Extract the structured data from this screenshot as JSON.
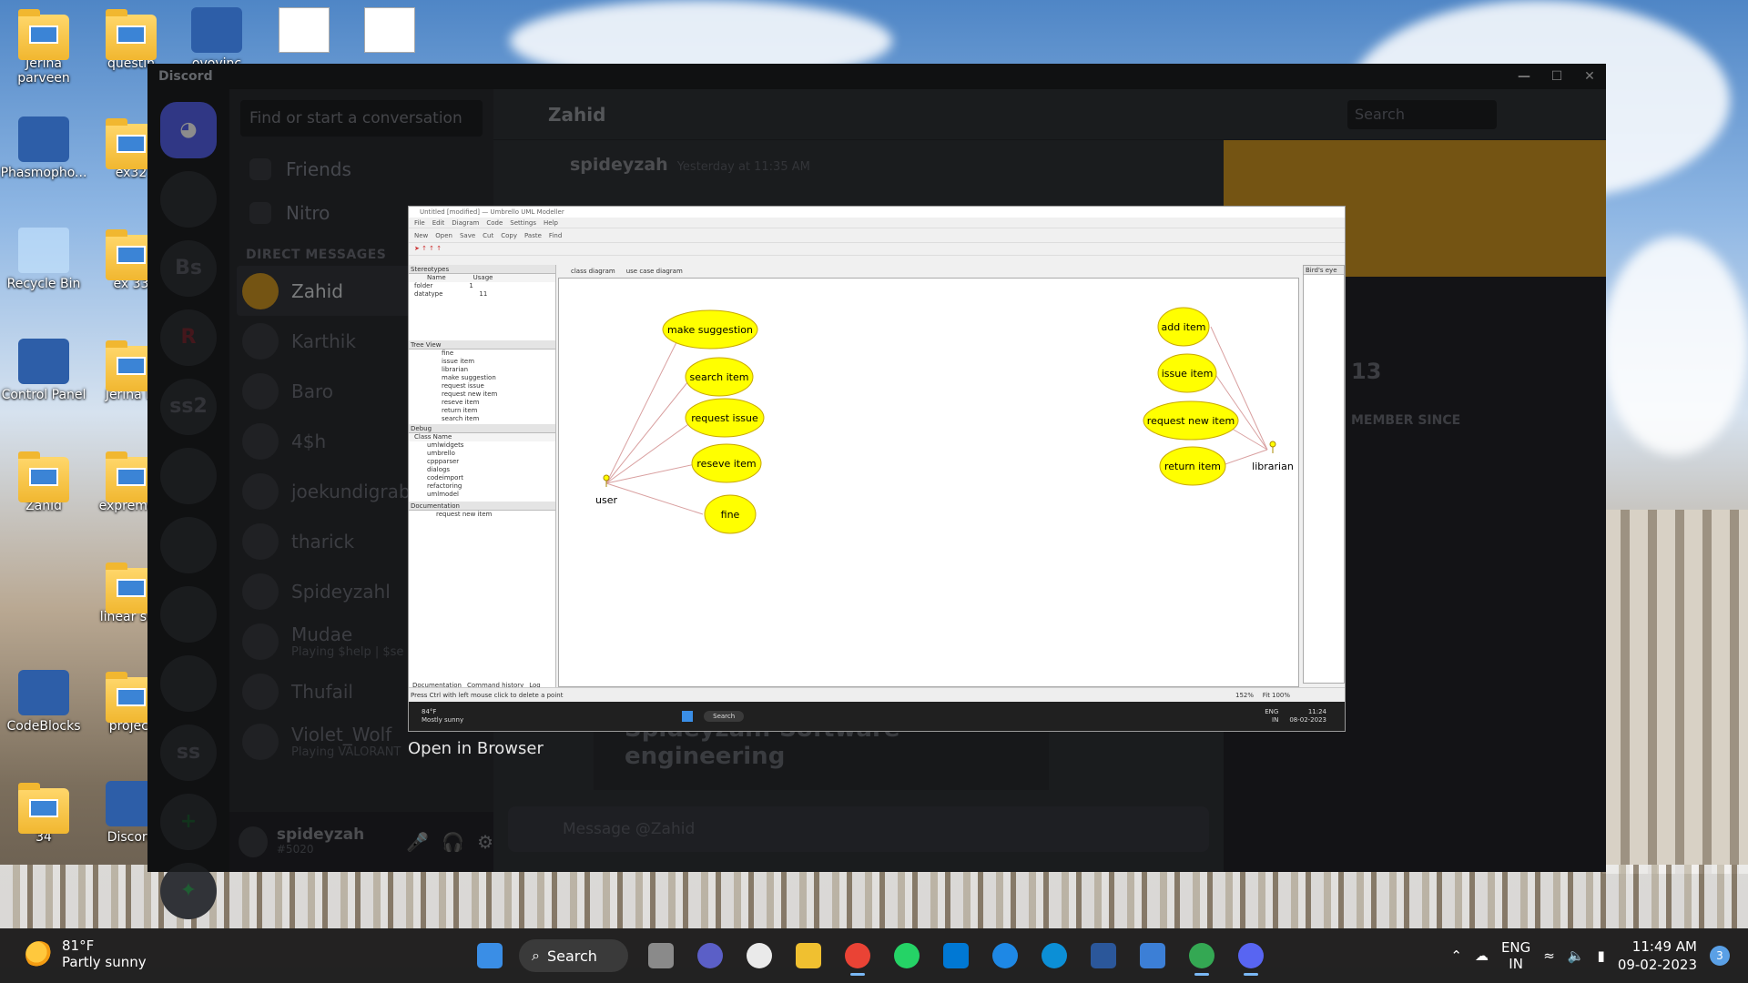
{
  "desktop": {
    "icons": [
      {
        "label": "Jerina parveen",
        "kind": "folder"
      },
      {
        "label": "questin",
        "kind": "folder"
      },
      {
        "label": "ovovinc",
        "kind": "app"
      },
      {
        "label": "",
        "kind": "doc"
      },
      {
        "label": "",
        "kind": "doc"
      },
      {
        "label": "Phasmopho...",
        "kind": "app"
      },
      {
        "label": "ex32",
        "kind": "folder"
      },
      {
        "label": "Recycle Bin",
        "kind": "bin"
      },
      {
        "label": "ex 33",
        "kind": "folder"
      },
      {
        "label": "Control Panel",
        "kind": "app"
      },
      {
        "label": "Jerina M",
        "kind": "folder"
      },
      {
        "label": "Zahid",
        "kind": "folder"
      },
      {
        "label": "expremen",
        "kind": "folder"
      },
      {
        "label": "linear sea",
        "kind": "folder"
      },
      {
        "label": "CodeBlocks",
        "kind": "app"
      },
      {
        "label": "project",
        "kind": "folder"
      },
      {
        "label": "34",
        "kind": "folder"
      },
      {
        "label": "Discord",
        "kind": "app"
      }
    ]
  },
  "discord": {
    "title": "Discord",
    "search_placeholder": "Find or start a conversation",
    "nav": [
      "Friends",
      "Nitro"
    ],
    "dm_header": "DIRECT MESSAGES",
    "guilds": [
      "Bs",
      "ss2",
      "ss"
    ],
    "dms": [
      {
        "name": "Zahid",
        "sub": ""
      },
      {
        "name": "Karthik",
        "sub": ""
      },
      {
        "name": "Baro",
        "sub": ""
      },
      {
        "name": "4$h",
        "sub": ""
      },
      {
        "name": "joekundigrabe",
        "sub": ""
      },
      {
        "name": "tharick",
        "sub": ""
      },
      {
        "name": "Spideyzahl",
        "sub": ""
      },
      {
        "name": "Mudae",
        "sub": "Playing $help | $se"
      },
      {
        "name": "Thufail",
        "sub": ""
      },
      {
        "name": "Violet_Wolf",
        "sub": "Playing VALORANT"
      }
    ],
    "user": {
      "name": "spideyzah",
      "tag": "#5020"
    },
    "header_name": "Zahid",
    "header_search": "Search",
    "message_author": "spideyzah",
    "message_time": "Yesterday at 11:35 AM",
    "embed_text": "Spideyzah: Software engineering",
    "profile": {
      "member_since": "MEMBER SINCE",
      "year_fragment": "13"
    },
    "message_placeholder": "Message @Zahid",
    "open_in_browser": "Open in Browser"
  },
  "umbrello": {
    "title": "Untitled [modified] — Umbrello UML Modeller",
    "menu": [
      "File",
      "Edit",
      "Diagram",
      "Code",
      "Settings",
      "Help"
    ],
    "toolbar": [
      "New",
      "Open",
      "Save",
      "Cut",
      "Copy",
      "Paste",
      "Find"
    ],
    "stereotypes_title": "Stereotypes",
    "stereotypes_cols": [
      "Name",
      "Usage"
    ],
    "stereotypes_rows": [
      [
        "folder",
        "1"
      ],
      [
        "datatype",
        "11"
      ]
    ],
    "tree_title": "Tree View",
    "tree_items": [
      "fine",
      "issue item",
      "librarian",
      "make suggestion",
      "request issue",
      "request new item",
      "reseve item",
      "return item",
      "search item"
    ],
    "debug_title": "Debug",
    "debug_col": "Class Name",
    "debug_items": [
      "umlwidgets",
      "umbrello",
      "cppparser",
      "dialogs",
      "codeimport",
      "refactoring",
      "umlmodel"
    ],
    "doc_title": "Documentation",
    "doc_value": "request new item",
    "bottom_tabs": [
      "Documentation",
      "Command history",
      "Log"
    ],
    "tabs": [
      "class diagram",
      "use case diagram"
    ],
    "right_pane_title": "Bird's eye",
    "status": "Press Ctrl with left mouse click to delete a point",
    "zoom": "152%",
    "fit": "Fit",
    "zoom100": "100%",
    "actors": {
      "user": "user",
      "librarian": "librarian"
    },
    "user_cases": [
      "make suggestion",
      "search item",
      "request issue",
      "reseve item",
      "fine"
    ],
    "librarian_cases": [
      "add item",
      "issue item",
      "request new item",
      "return item"
    ],
    "inner_taskbar": {
      "temp": "84°F",
      "weather": "Mostly sunny",
      "search": "Search",
      "lang1": "ENG",
      "lang2": "IN",
      "time": "11:24",
      "date": "08-02-2023"
    }
  },
  "taskbar": {
    "temp": "81°F",
    "weather": "Partly sunny",
    "search": "Search",
    "lang1": "ENG",
    "lang2": "IN",
    "time": "11:49 AM",
    "date": "09-02-2023",
    "notif_count": "3",
    "apps": [
      "start-icon",
      "search",
      "task-view-icon",
      "teams-icon",
      "steam-icon",
      "file-explorer-icon",
      "chrome-icon",
      "whatsapp-icon",
      "store-icon",
      "help-icon",
      "edge-icon",
      "word-icon",
      "notepad-icon",
      "chrome-profile-icon",
      "discord-icon"
    ]
  }
}
